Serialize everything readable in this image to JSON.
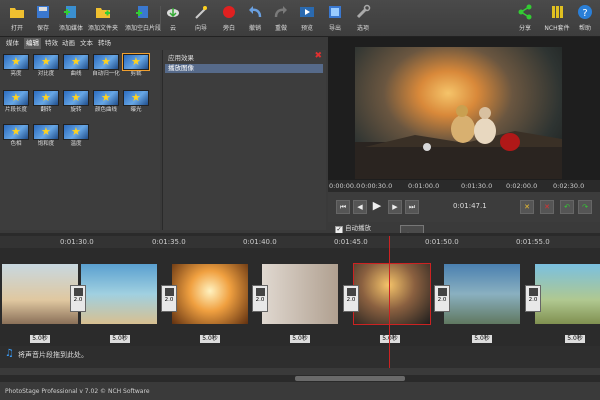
{
  "toolbar": {
    "items": [
      {
        "label": "打开",
        "icon": "folder-open-icon"
      },
      {
        "label": "保存",
        "icon": "save-icon"
      },
      {
        "label": "添加媒体",
        "icon": "add-media-icon"
      },
      {
        "label": "添加文件夹",
        "icon": "add-folder-icon"
      },
      {
        "label": "添加空白片段",
        "icon": "add-blank-slide-icon"
      },
      {
        "label": "云",
        "icon": "cloud-icon"
      },
      {
        "label": "向导",
        "icon": "wizard-wand-icon"
      },
      {
        "label": "旁白",
        "icon": "record-icon"
      },
      {
        "label": "撤销",
        "icon": "undo-icon"
      },
      {
        "label": "重做",
        "icon": "redo-icon"
      },
      {
        "label": "预览",
        "icon": "preview-icon"
      },
      {
        "label": "导出",
        "icon": "export-film-icon"
      },
      {
        "label": "选项",
        "icon": "options-tools-icon"
      }
    ],
    "right": [
      {
        "label": "分享",
        "icon": "share-icon"
      },
      {
        "label": "NCH套件",
        "icon": "nch-suite-icon"
      },
      {
        "label": "帮助",
        "icon": "help-icon"
      }
    ]
  },
  "tabs": [
    "媒体",
    "编辑",
    "特效",
    "动画",
    "文本",
    "转场"
  ],
  "effects": [
    {
      "label": "亮度"
    },
    {
      "label": "对比度"
    },
    {
      "label": "曲线"
    },
    {
      "label": "自动归一化"
    },
    {
      "label": "剪裁"
    },
    {
      "label": "片段长度"
    },
    {
      "label": "翻转"
    },
    {
      "label": "旋转"
    },
    {
      "label": "颜色曲线"
    },
    {
      "label": "曝光"
    },
    {
      "label": "色相"
    },
    {
      "label": "饱和度"
    },
    {
      "label": "温度"
    }
  ],
  "applied": {
    "header": "应用效果",
    "row": "播放图像"
  },
  "preview_ruler": [
    "0:00:00.0",
    "0:00:30.0",
    "0:01:00.0",
    "0:01:30.0",
    "0:02:00.0",
    "0:02:30.0"
  ],
  "timecode": "0:01:47.1",
  "autoplay": "自动播放",
  "timeline_ruler": [
    "0:01:30.0",
    "0:01:35.0",
    "0:01:40.0",
    "0:01:45.0",
    "0:01:50.0",
    "0:01:55.0"
  ],
  "transition_duration": "2.0",
  "clip_durations": [
    "5.0秒",
    "5.0秒",
    "5.0秒",
    "5.0秒",
    "5.0秒",
    "5.0秒",
    "5.0秒"
  ],
  "audio_hint": "将声音片段拖到此处。",
  "status": "PhotoStage Professional v 7.02 © NCH Software",
  "colors": {
    "accent": "#f0a030",
    "playhead": "#cc2222",
    "selected_row": "#566a8a"
  }
}
